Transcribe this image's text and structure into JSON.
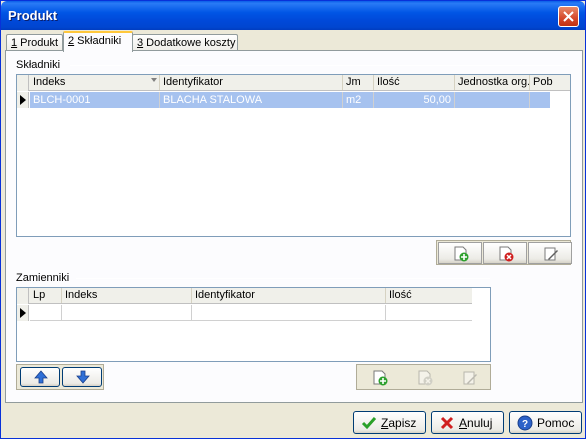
{
  "window": {
    "title": "Produkt"
  },
  "tabs": [
    {
      "key": "1",
      "label": " Produkt"
    },
    {
      "key": "2",
      "label": " Składniki"
    },
    {
      "key": "3",
      "label": " Dodatkowe koszty"
    }
  ],
  "skladniki": {
    "group_label": "Składniki",
    "columns": [
      "Indeks",
      "Identyfikator",
      "Jm",
      "Ilość",
      "Jednostka org.",
      "Pob"
    ],
    "rows": [
      {
        "indeks": "BLCH-0001",
        "identyfikator": "BLACHA STALOWA",
        "jm": "m2",
        "ilosc": "50,00",
        "jednostka": "",
        "pob": ""
      }
    ]
  },
  "zamienniki": {
    "group_label": "Zamienniki",
    "columns": [
      "Lp",
      "Indeks",
      "Identyfikator",
      "Ilość"
    ]
  },
  "buttons": {
    "save_key": "Z",
    "save_rest": "apisz",
    "cancel_key": "A",
    "cancel_rest": "nuluj",
    "help": "Pomoc"
  },
  "colors": {
    "titlebar": "#0055e5",
    "selected_row": "#a6c2ef",
    "tab_highlight": "#ffc83c"
  },
  "icons": [
    "close-icon",
    "add-icon",
    "delete-icon",
    "edit-icon",
    "arrow-up-icon",
    "arrow-down-icon",
    "check-icon",
    "cancel-x-icon",
    "help-icon"
  ]
}
